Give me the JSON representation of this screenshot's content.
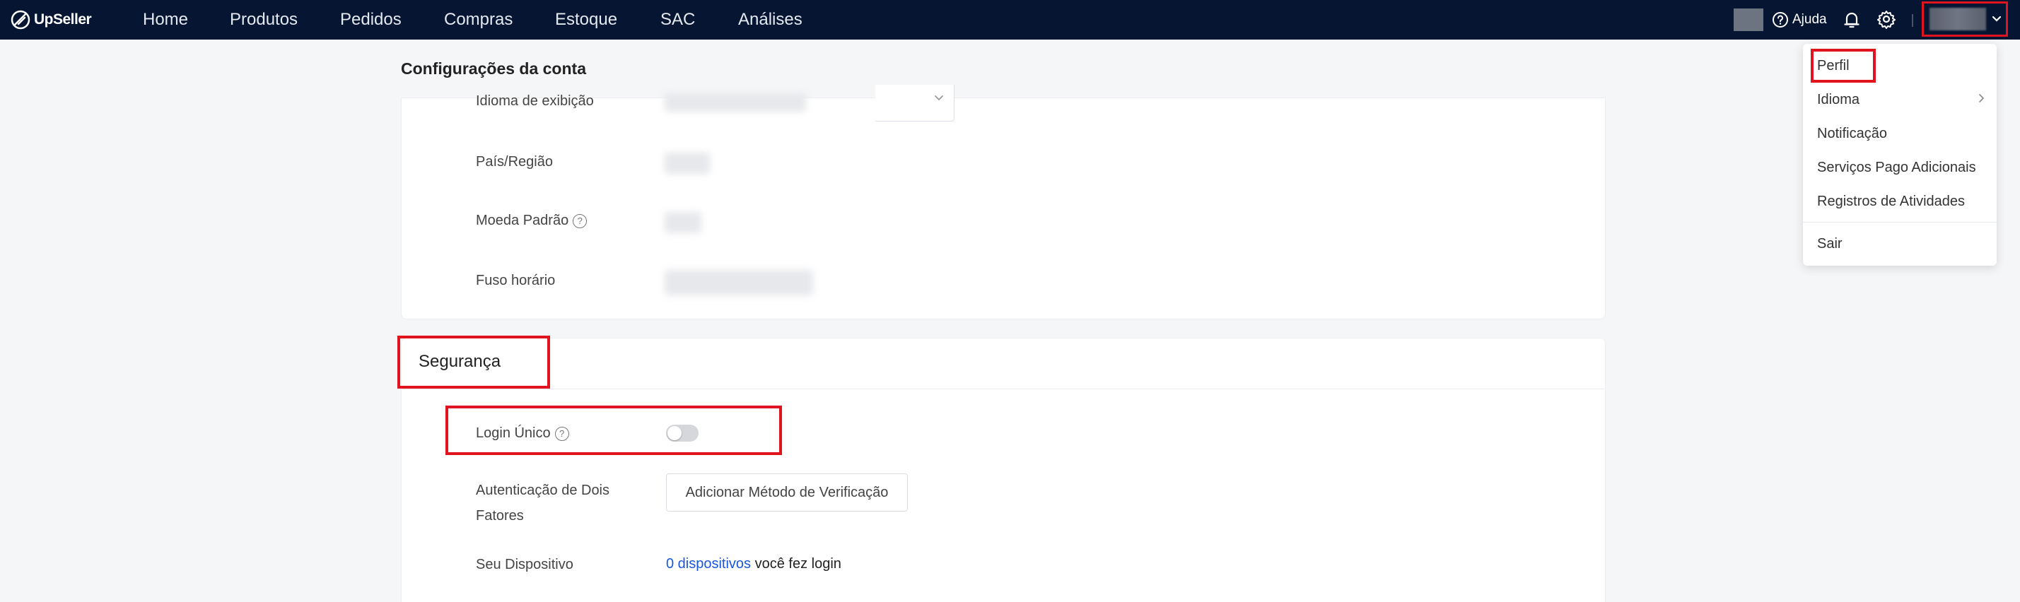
{
  "brand": {
    "name": "UpSeller"
  },
  "nav": {
    "items": [
      {
        "label": "Home"
      },
      {
        "label": "Produtos"
      },
      {
        "label": "Pedidos"
      },
      {
        "label": "Compras"
      },
      {
        "label": "Estoque"
      },
      {
        "label": "SAC"
      },
      {
        "label": "Análises"
      }
    ],
    "help_label": "Ajuda"
  },
  "page": {
    "title": "Configurações da conta"
  },
  "account": {
    "fields": [
      {
        "label": "Idioma de exibição"
      },
      {
        "label": "País/Região"
      },
      {
        "label": "Moeda Padrão"
      },
      {
        "label": "Fuso horário"
      }
    ]
  },
  "security": {
    "title": "Segurança",
    "single_login": {
      "label": "Login Único",
      "enabled": false
    },
    "two_factor": {
      "label_line1": "Autenticação de Dois",
      "label_line2": "Fatores",
      "button": "Adicionar Método de Verificação"
    },
    "device": {
      "label": "Seu Dispositivo",
      "link": "0 dispositivos",
      "suffix": "você fez login"
    }
  },
  "dropdown": {
    "items": [
      {
        "label": "Perfil"
      },
      {
        "label": "Idioma"
      },
      {
        "label": "Notificação"
      },
      {
        "label": "Serviços Pago Adicionais"
      },
      {
        "label": "Registros de Atividades"
      },
      {
        "label": "Sair"
      }
    ]
  },
  "colors": {
    "nav_bg": "#061632",
    "annotation": "#e0141e",
    "link": "#1a56db"
  }
}
